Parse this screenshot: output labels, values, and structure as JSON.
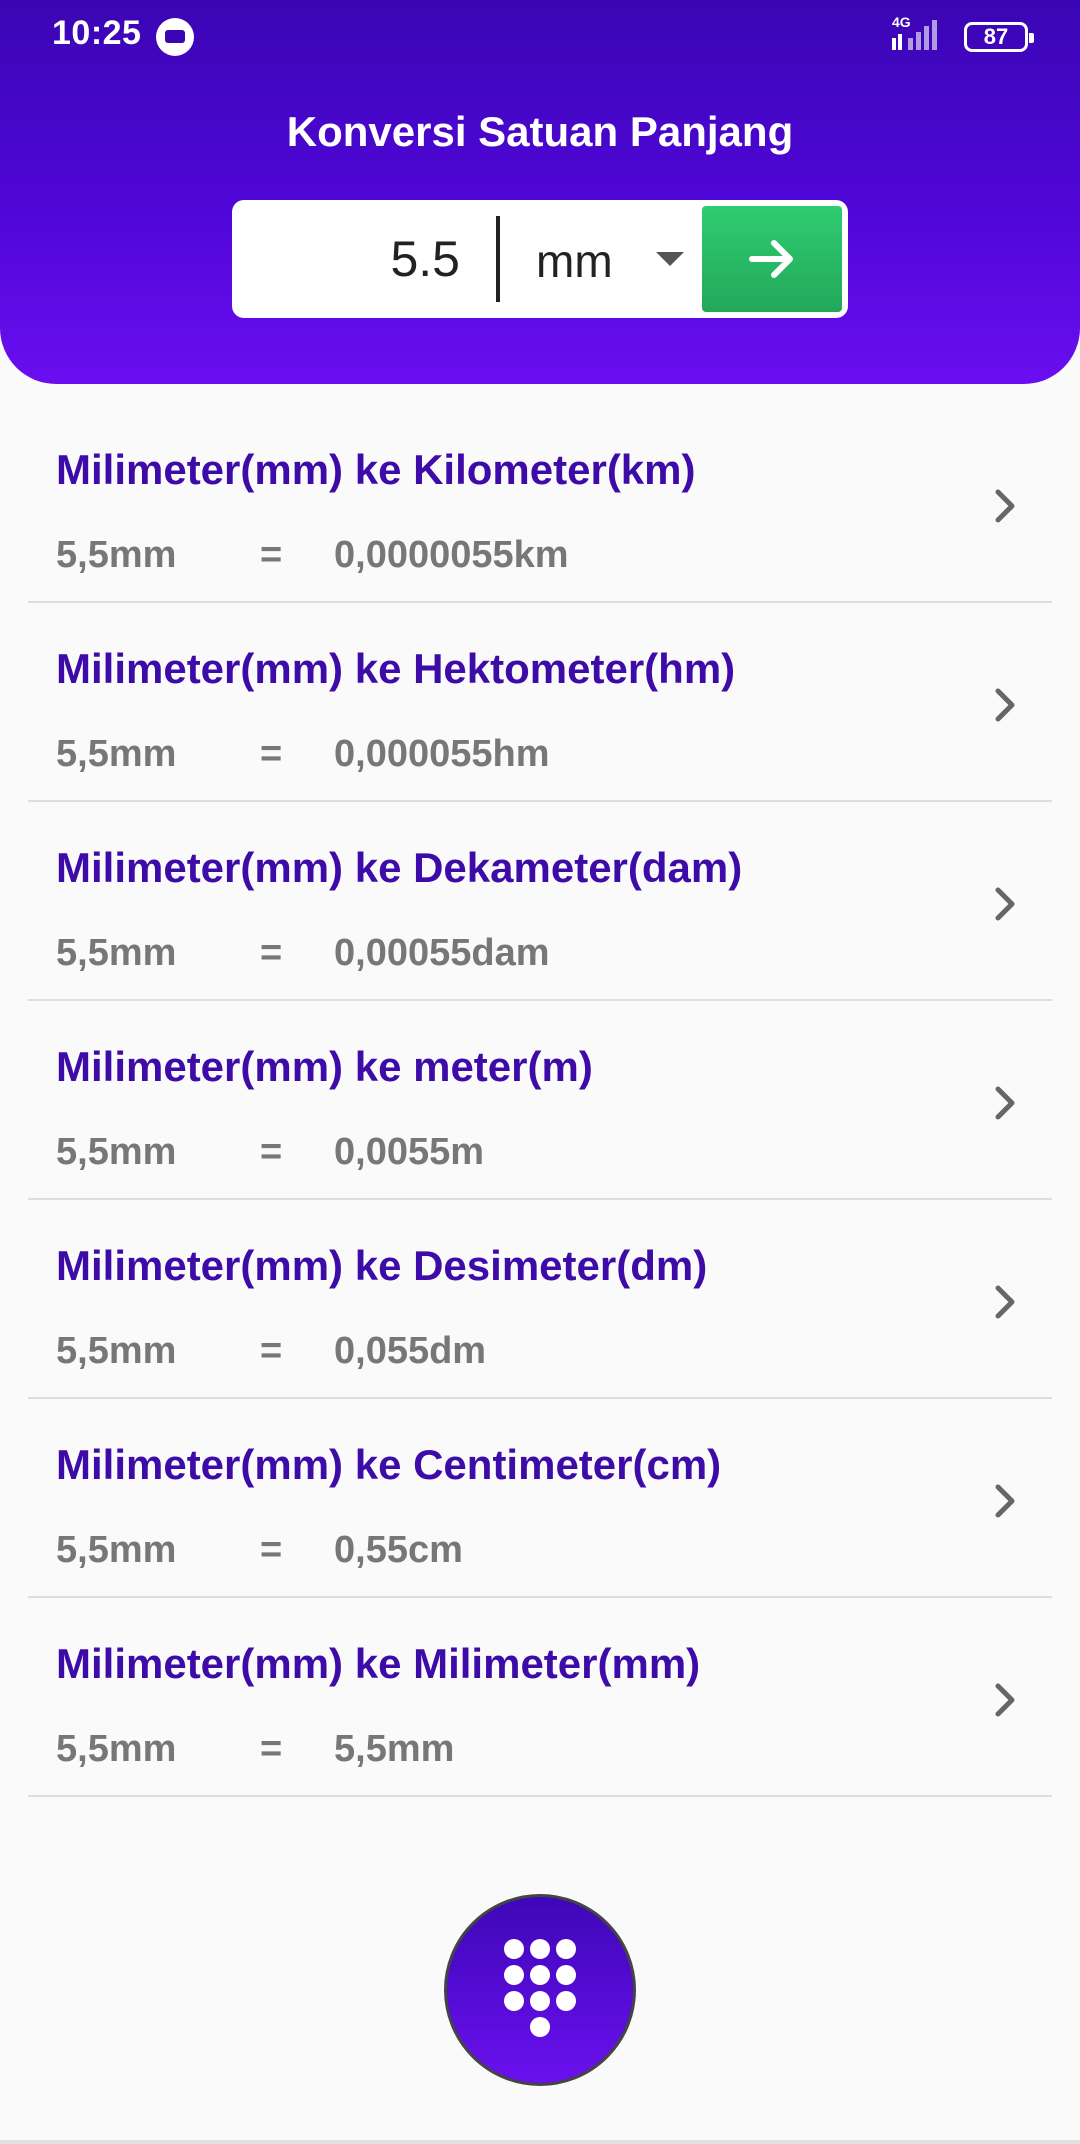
{
  "status_bar": {
    "time": "10:25",
    "network": "4G",
    "battery": "87"
  },
  "header": {
    "title": "Konversi Satuan Panjang"
  },
  "converter": {
    "value": "5.5",
    "unit": "mm"
  },
  "conversions": [
    {
      "title": "Milimeter(mm) ke Kilometer(km)",
      "from": "5,5mm",
      "equals": "=",
      "to": "0,0000055km"
    },
    {
      "title": "Milimeter(mm) ke Hektometer(hm)",
      "from": "5,5mm",
      "equals": "=",
      "to": "0,000055hm"
    },
    {
      "title": "Milimeter(mm) ke Dekameter(dam)",
      "from": "5,5mm",
      "equals": "=",
      "to": "0,00055dam"
    },
    {
      "title": "Milimeter(mm) ke meter(m)",
      "from": "5,5mm",
      "equals": "=",
      "to": "0,0055m"
    },
    {
      "title": "Milimeter(mm) ke Desimeter(dm)",
      "from": "5,5mm",
      "equals": "=",
      "to": "0,055dm"
    },
    {
      "title": "Milimeter(mm) ke Centimeter(cm)",
      "from": "5,5mm",
      "equals": "=",
      "to": "0,55cm"
    },
    {
      "title": "Milimeter(mm) ke Milimeter(mm)",
      "from": "5,5mm",
      "equals": "=",
      "to": "5,5mm"
    }
  ],
  "icons": {
    "go_button": "arrow-right-icon",
    "list_chevron": "chevron-right-icon",
    "fab": "keypad-icon"
  },
  "colors": {
    "header_top": "#3a06b4",
    "header_bottom": "#6a0ef0",
    "go_button": "#2ecc71",
    "item_title": "#3d0ca8",
    "item_result": "#777777"
  }
}
